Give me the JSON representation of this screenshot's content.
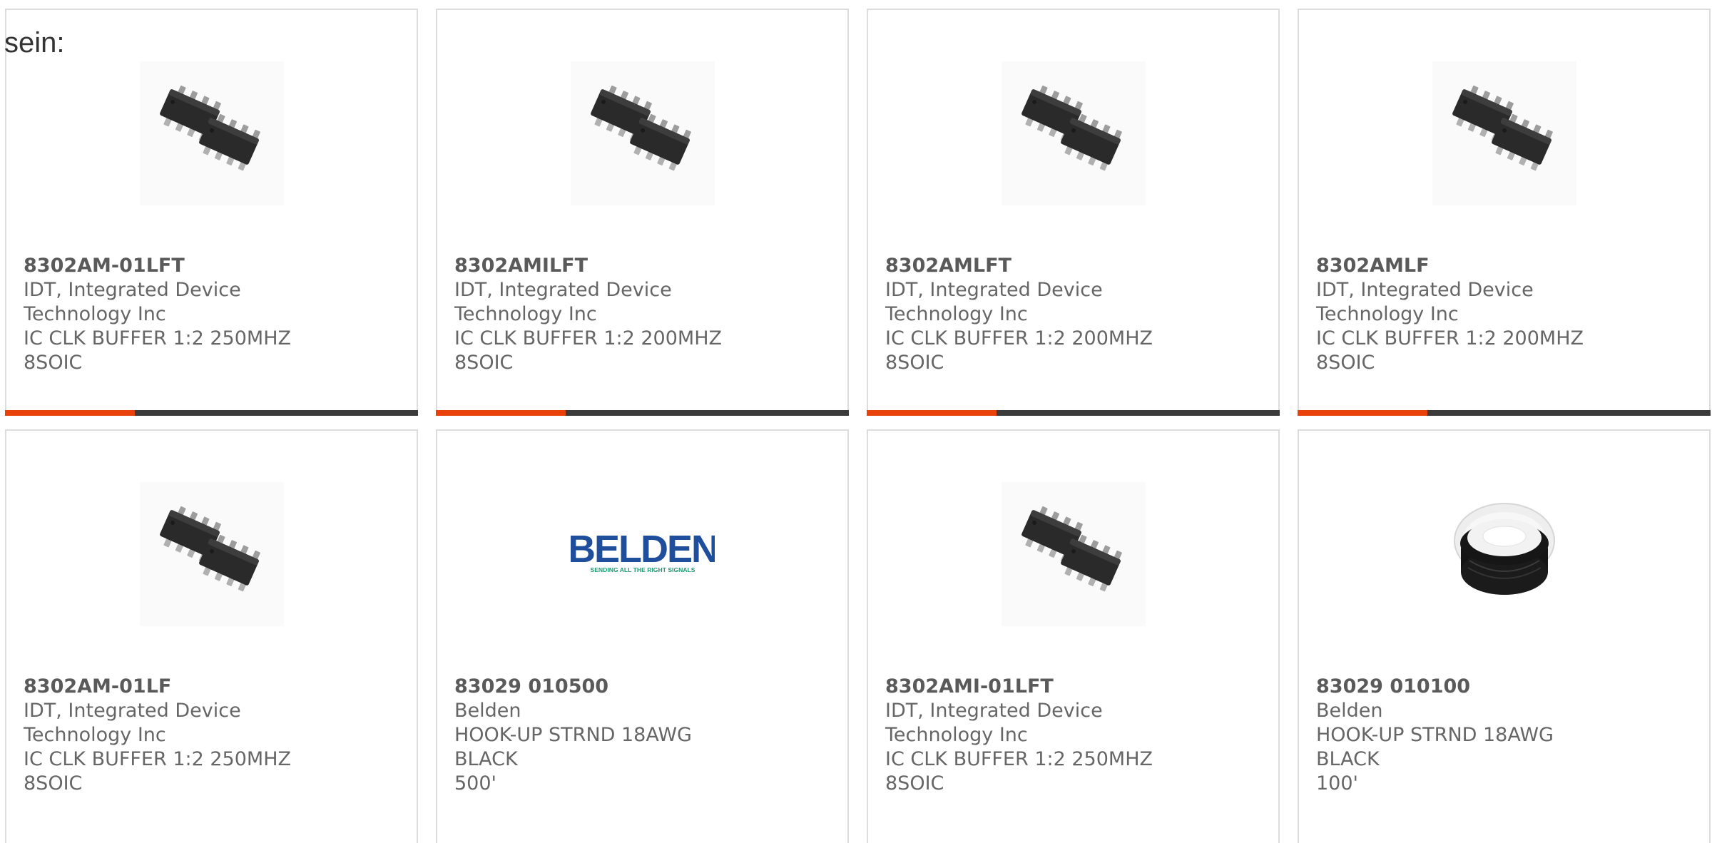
{
  "page_label": "sein:",
  "colors": {
    "accent": "#e8410a",
    "bar": "#3b3b3b",
    "card_border": "#dcdcdc",
    "text": "#666666"
  },
  "products": [
    {
      "part_number": "8302AM-01LFT",
      "manufacturer_line1": "IDT, Integrated Device",
      "manufacturer_line2": "Technology Inc",
      "description_line1": "IC CLK BUFFER 1:2 250MHZ",
      "description_line2": "8SOIC",
      "image": "soic-chip-icon"
    },
    {
      "part_number": "8302AMILFT",
      "manufacturer_line1": "IDT, Integrated Device",
      "manufacturer_line2": "Technology Inc",
      "description_line1": "IC CLK BUFFER 1:2 200MHZ",
      "description_line2": "8SOIC",
      "image": "soic-chip-icon"
    },
    {
      "part_number": "8302AMLFT",
      "manufacturer_line1": "IDT, Integrated Device",
      "manufacturer_line2": "Technology Inc",
      "description_line1": "IC CLK BUFFER 1:2 200MHZ",
      "description_line2": "8SOIC",
      "image": "soic-chip-icon"
    },
    {
      "part_number": "8302AMLF",
      "manufacturer_line1": "IDT, Integrated Device",
      "manufacturer_line2": "Technology Inc",
      "description_line1": "IC CLK BUFFER 1:2 200MHZ",
      "description_line2": "8SOIC",
      "image": "soic-chip-icon"
    },
    {
      "part_number": "8302AM-01LF",
      "manufacturer_line1": "IDT, Integrated Device",
      "manufacturer_line2": "Technology Inc",
      "description_line1": "IC CLK BUFFER 1:2 250MHZ",
      "description_line2": "8SOIC",
      "image": "soic-chip-icon"
    },
    {
      "part_number": "83029 010500",
      "manufacturer_line1": "Belden",
      "manufacturer_line2": "",
      "description_line1": "HOOK-UP STRND 18AWG BLACK",
      "description_line2": "500'",
      "image": "belden-logo",
      "logo_text": "BELDEN",
      "logo_tagline": "SENDING ALL THE RIGHT SIGNALS"
    },
    {
      "part_number": "8302AMI-01LFT",
      "manufacturer_line1": "IDT, Integrated Device",
      "manufacturer_line2": "Technology Inc",
      "description_line1": "IC CLK BUFFER 1:2 250MHZ",
      "description_line2": "8SOIC",
      "image": "soic-chip-icon"
    },
    {
      "part_number": "83029 010100",
      "manufacturer_line1": "Belden",
      "manufacturer_line2": "",
      "description_line1": "HOOK-UP STRND 18AWG BLACK",
      "description_line2": "100'",
      "image": "wire-spool-icon"
    }
  ]
}
